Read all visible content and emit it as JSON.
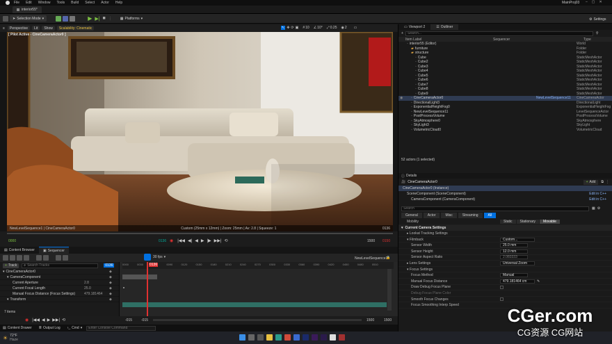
{
  "app": {
    "menu": [
      "File",
      "Edit",
      "Window",
      "Tools",
      "Build",
      "Select",
      "Actor",
      "Help"
    ],
    "project": "MainProj03",
    "level_tab": "interior55*"
  },
  "toolbar": {
    "mode": "Selection Mode",
    "platforms": "Platforms",
    "settings": "Settings"
  },
  "viewport": {
    "chips": [
      "Perspective",
      "Lit",
      "Show",
      "Scalability: Cinematic"
    ],
    "pilot_label": "[ Pilot Active - CineCameraActor0 ]",
    "right_readouts": [
      "10",
      "10°",
      "0.25",
      "2"
    ],
    "footer_left": "NewLevelSequence1 | CineCameraActor0",
    "footer_center": "Custom (25mm x 12mm) | Zoom: 25mm | Av: 2.8 | Squeeze: 1",
    "footer_right": "0136"
  },
  "transport": {
    "start": "0000",
    "current": "0136",
    "end": "1500",
    "end_red": "0150"
  },
  "low_tabs": [
    "Content Browser",
    "Sequencer"
  ],
  "sequencer": {
    "fps": "30 fps",
    "add_track": "Track",
    "search_placeholder": "Search Tracks",
    "current_frame": "0136",
    "sequence_name": "NewLevelSequence11",
    "ruler": [
      "0000",
      "0030",
      "0060",
      "0090",
      "0120",
      "0150",
      "0180",
      "0210",
      "0240",
      "0270",
      "0300",
      "0330",
      "0360",
      "0390",
      "0420",
      "0450",
      "0480",
      "0510"
    ],
    "tree": [
      {
        "label": "CineCameraActor0",
        "indent": 0
      },
      {
        "label": "CameraComponent",
        "indent": 1
      },
      {
        "label": "Current Aperture",
        "indent": 2,
        "value": "2.8"
      },
      {
        "label": "Current Focal Length",
        "indent": 2,
        "value": "25.0"
      },
      {
        "label": "Manual Focus Distance (Focus Settings)",
        "indent": 2,
        "value": "479.181464"
      },
      {
        "label": "Transform",
        "indent": 1
      }
    ],
    "items_count": "7 items",
    "foot_left": "-015",
    "foot_left2": "-015",
    "foot_right": "1500",
    "foot_right2": "1500"
  },
  "statusbar": {
    "content_drawer": "Content Drawer",
    "output_log": "Output Log",
    "cmd": "Cmd",
    "console_placeholder": "Enter Console Command"
  },
  "taskbar": {
    "weather": "72°F",
    "weather_sub": "Haze"
  },
  "outliner": {
    "tabs": [
      "Viewport 2",
      "Outliner"
    ],
    "search_placeholder": "Search...",
    "col_label": "Item Label",
    "col_seq": "Sequencer",
    "col_type": "Type",
    "rows": [
      {
        "label": "interior55 (Editor)",
        "indent": 0,
        "type": "World",
        "seq": ""
      },
      {
        "label": "furniture",
        "indent": 1,
        "type": "Folder",
        "seq": ""
      },
      {
        "label": "structure",
        "indent": 1,
        "type": "Folder",
        "seq": ""
      },
      {
        "label": "Cube",
        "indent": 2,
        "type": "StaticMeshActor",
        "seq": ""
      },
      {
        "label": "Cube2",
        "indent": 2,
        "type": "StaticMeshActor",
        "seq": ""
      },
      {
        "label": "Cube3",
        "indent": 2,
        "type": "StaticMeshActor",
        "seq": ""
      },
      {
        "label": "Cube4",
        "indent": 2,
        "type": "StaticMeshActor",
        "seq": ""
      },
      {
        "label": "Cube5",
        "indent": 2,
        "type": "StaticMeshActor",
        "seq": ""
      },
      {
        "label": "Cube6",
        "indent": 2,
        "type": "StaticMeshActor",
        "seq": ""
      },
      {
        "label": "Cube7",
        "indent": 2,
        "type": "StaticMeshActor",
        "seq": ""
      },
      {
        "label": "Cube8",
        "indent": 2,
        "type": "StaticMeshActor",
        "seq": ""
      },
      {
        "label": "Cube9",
        "indent": 2,
        "type": "StaticMeshActor",
        "seq": ""
      },
      {
        "label": "CineCameraActor0",
        "indent": 1,
        "type": "CineCameraActor",
        "seq": "NewLevelSequence11",
        "selected": true
      },
      {
        "label": "DirectionalLight3",
        "indent": 1,
        "type": "DirectionalLight",
        "seq": ""
      },
      {
        "label": "ExponentialHeightFog0",
        "indent": 1,
        "type": "ExponentialHeightFog",
        "seq": ""
      },
      {
        "label": "NewLevelSequence11",
        "indent": 1,
        "type": "LevelSequenceActor",
        "seq": ""
      },
      {
        "label": "PostProcessVolume",
        "indent": 1,
        "type": "PostProcessVolume",
        "seq": ""
      },
      {
        "label": "SkyAtmosphere0",
        "indent": 1,
        "type": "SkyAtmosphere",
        "seq": ""
      },
      {
        "label": "SkyLight3",
        "indent": 1,
        "type": "SkyLight",
        "seq": ""
      },
      {
        "label": "VolumetricCloud0",
        "indent": 1,
        "type": "VolumetricCloud",
        "seq": ""
      }
    ],
    "count": "52 actors (1 selected)"
  },
  "details": {
    "tab": "Details",
    "actor": "CineCameraActor0",
    "add": "Add",
    "instance": "CineCameraActor0 (Instance)",
    "components": [
      {
        "label": "SceneComponent (SceneComponent)",
        "edit": "Edit in C++"
      },
      {
        "label": "CameraComponent (CameraComponent)",
        "edit": "Edit in C++"
      }
    ],
    "search_placeholder": "Search",
    "filters": [
      "General",
      "Actor",
      "Misc",
      "Streaming",
      "All"
    ],
    "mobility_label": "Mobility",
    "mobility": [
      "Static",
      "Stationary",
      "Movable"
    ],
    "sections": {
      "camera": "Current Camera Settings",
      "tracking": "Lookat Tracking Settings",
      "filmback": "Filmback",
      "lens": "Lens Settings",
      "focus": "Focus Settings"
    },
    "props": {
      "filmback": "Custom...",
      "sensor_width": {
        "k": "Sensor Width",
        "v": "25.0 mm"
      },
      "sensor_height": {
        "k": "Sensor Height",
        "v": "12.0 mm"
      },
      "aspect": {
        "k": "Sensor Aspect Ratio",
        "v": "2.083333"
      },
      "lens": "Universal Zoom",
      "focus_method": {
        "k": "Focus Method",
        "v": "Manual"
      },
      "focus_dist": {
        "k": "Manual Focus Distance",
        "v": "479.181464 cm"
      },
      "draw_plane": "Draw Debug Focus Plane",
      "plane_color": "Debug Focus Plane Color",
      "smooth": "Smooth Focus Changes",
      "interp": "Focus Smoothing Interp Speed"
    }
  },
  "watermark": {
    "main": "CGer.com",
    "sub": "CG资源 CG网站"
  },
  "colors": {
    "accent": "#0070e0",
    "play_green": "#7dc242",
    "record_red": "#e03030",
    "selection": "#2f3b52",
    "track_teal": "#2f6f64"
  }
}
